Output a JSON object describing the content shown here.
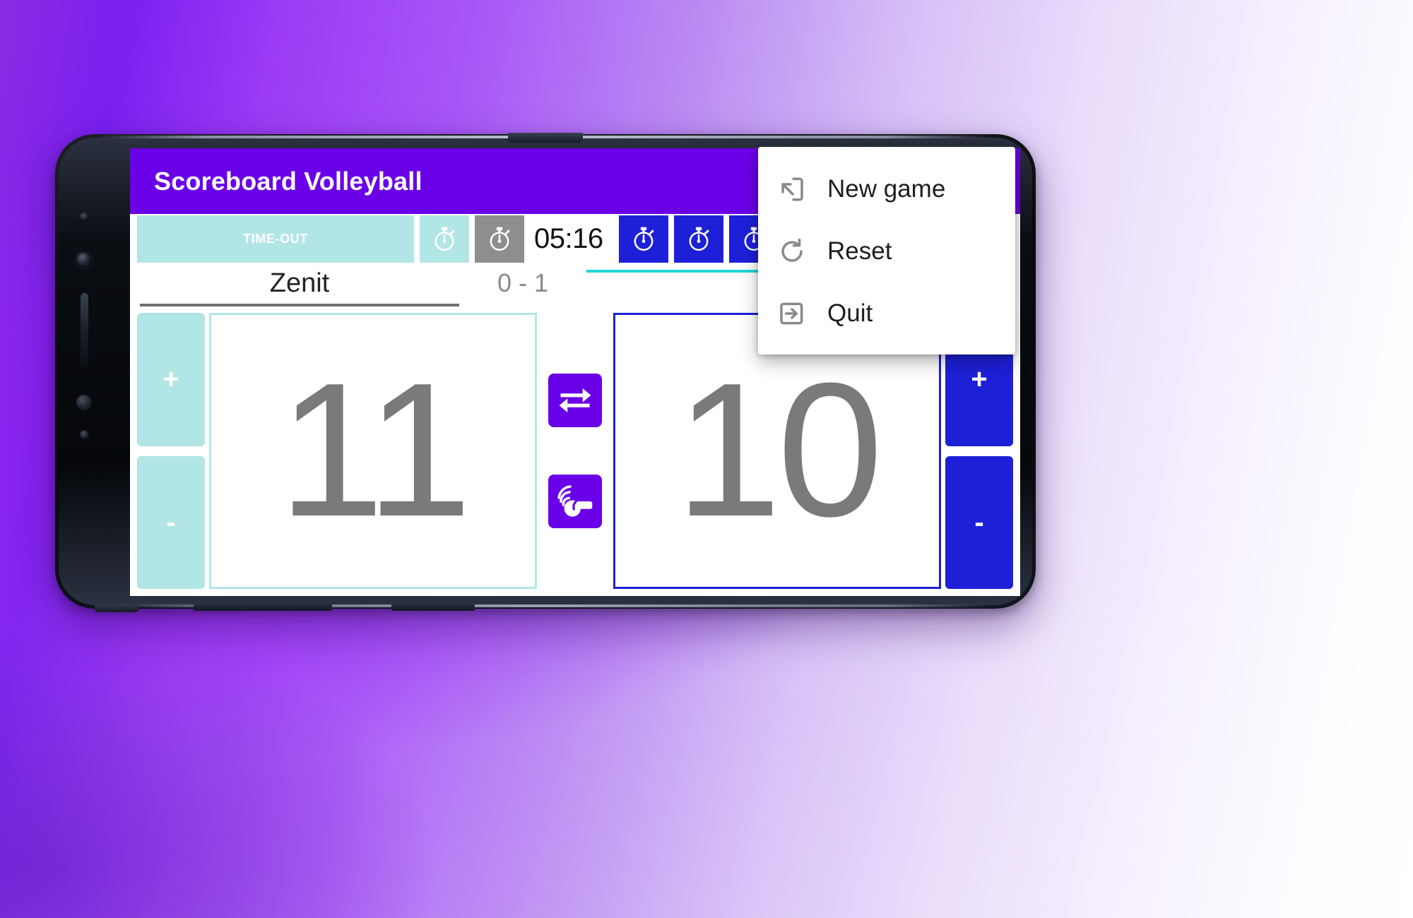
{
  "app": {
    "title": "Scoreboard Volleyball",
    "accent_purple": "#6a00e8",
    "accent_teal": "#b2e6e6",
    "accent_blue": "#1e20d8",
    "gray": "#8e8e8e"
  },
  "toolbar": {
    "timeout_label": "TIME-OUT",
    "clock": "05:16",
    "timers": [
      {
        "name": "timer-teal",
        "state": "teal",
        "icon": "stopwatch-icon"
      },
      {
        "name": "timer-gray",
        "state": "gray",
        "icon": "stopwatch-icon"
      },
      {
        "name": "timer-blue-1",
        "state": "blue",
        "icon": "stopwatch-icon"
      },
      {
        "name": "timer-blue-2",
        "state": "blue",
        "icon": "stopwatch-icon"
      },
      {
        "name": "timer-blue-3",
        "state": "blue",
        "icon": "stopwatch-icon"
      }
    ]
  },
  "match": {
    "left_team": "Zenit",
    "right_team": "",
    "set_score": "0 - 1",
    "left_points": "11",
    "right_points": "10",
    "plus_label": "+",
    "minus_label": "-"
  },
  "center_actions": [
    {
      "name": "swap-sides-button",
      "icon": "swap-horizontal-icon"
    },
    {
      "name": "whistle-button",
      "icon": "whistle-icon"
    }
  ],
  "menu": {
    "items": [
      {
        "label": "New game",
        "icon": "exit-to-app-icon"
      },
      {
        "label": "Reset",
        "icon": "refresh-icon"
      },
      {
        "label": "Quit",
        "icon": "login-arrow-icon"
      }
    ]
  }
}
